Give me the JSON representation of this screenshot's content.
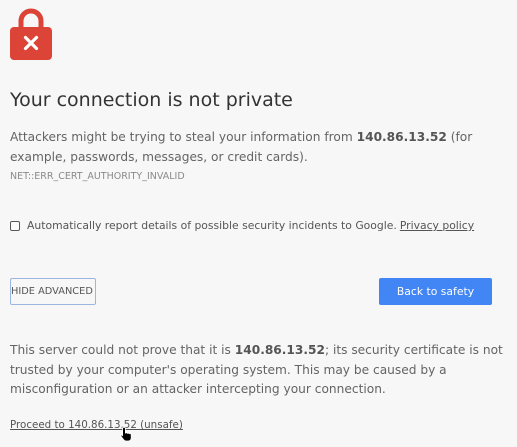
{
  "colors": {
    "background": "#f7f7f7",
    "lock_red": "#db4437",
    "primary_button": "#4285f4"
  },
  "icons": {
    "lock": "lock-error-icon",
    "cursor": "hand-pointer-icon"
  },
  "heading": "Your connection is not private",
  "main_message": {
    "before": "Attackers might be trying to steal your information from ",
    "host": "140.86.13.52",
    "after": " (for example, passwords, messages, or credit cards)."
  },
  "error_code": "NET::ERR_CERT_AUTHORITY_INVALID",
  "report": {
    "label": "Automatically report details of possible security incidents to Google.",
    "link": "Privacy policy"
  },
  "buttons": {
    "hide_advanced": "HIDE ADVANCED",
    "back_to_safety": "Back to safety"
  },
  "details": {
    "before": "This server could not prove that it is ",
    "host": "140.86.13.52",
    "after": "; its security certificate is not trusted by your computer's operating system. This may be caused by a misconfiguration or an attacker intercepting your connection."
  },
  "proceed_link": "Proceed to 140.86.13.52 (unsafe)"
}
